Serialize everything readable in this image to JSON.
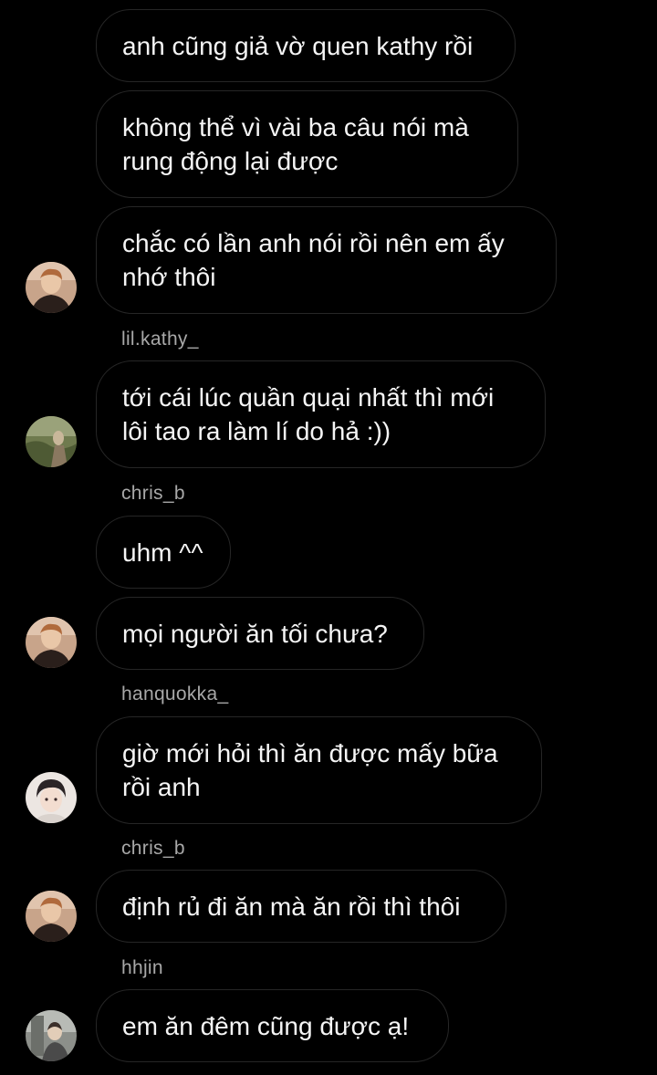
{
  "messages": [
    {
      "text": "anh cũng giả vờ quen kathy rồi"
    },
    {
      "text": "không thể vì vài ba câu nói mà rung động lại được"
    },
    {
      "text": "chắc có lần anh nói rồi nên em ấy nhớ thôi"
    },
    {
      "text": "tới cái lúc quần quại nhất thì mới lôi tao ra làm lí do hả :))"
    },
    {
      "text": "uhm ^^"
    },
    {
      "text": "mọi người ăn tối chưa?"
    },
    {
      "text": "giờ mới hỏi thì ăn được mấy bữa rồi anh"
    },
    {
      "text": "định rủ đi ăn mà ăn rồi thì thôi"
    },
    {
      "text": "em ăn đêm cũng được ạ!"
    }
  ],
  "senders": [
    {
      "name": "lil.kathy_"
    },
    {
      "name": "chris_b"
    },
    {
      "name": "hanquokka_"
    },
    {
      "name": "chris_b"
    },
    {
      "name": "hhjin"
    }
  ],
  "avatars": [
    {
      "icon": "user-avatar-photo",
      "palette": "warm"
    },
    {
      "icon": "user-avatar-photo",
      "palette": "green"
    },
    {
      "icon": "user-avatar-photo",
      "palette": "warm"
    },
    {
      "icon": "user-avatar-photo",
      "palette": "light"
    },
    {
      "icon": "user-avatar-photo",
      "palette": "warm"
    },
    {
      "icon": "user-avatar-photo",
      "palette": "grey"
    }
  ],
  "colors": {
    "background": "#000000",
    "bubble_border": "#262626",
    "message_text": "#f5f5f5",
    "sender_text": "#a8a8a8"
  }
}
